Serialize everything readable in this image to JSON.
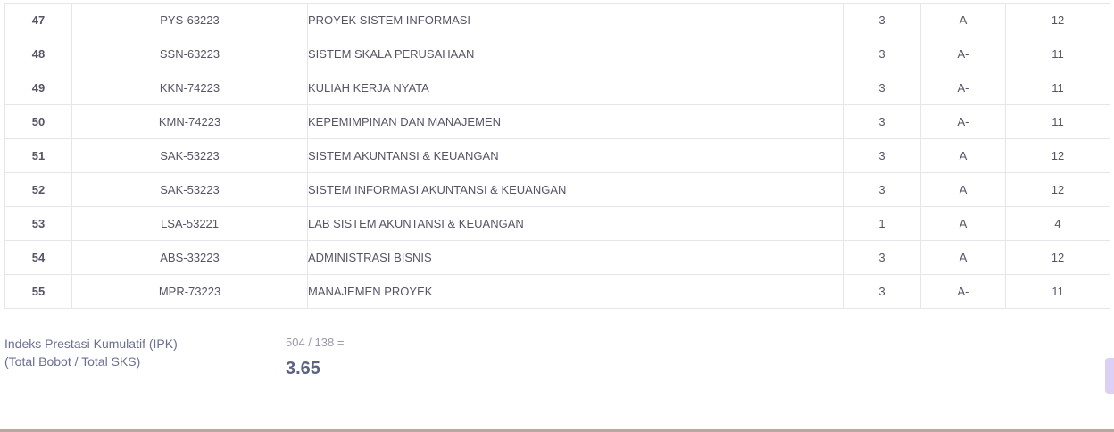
{
  "courses": [
    {
      "no": "47",
      "code": "PYS-63223",
      "name": "PROYEK SISTEM INFORMASI",
      "sks": "3",
      "grade": "A",
      "weight": "12"
    },
    {
      "no": "48",
      "code": "SSN-63223",
      "name": "SISTEM SKALA PERUSAHAAN",
      "sks": "3",
      "grade": "A-",
      "weight": "11"
    },
    {
      "no": "49",
      "code": "KKN-74223",
      "name": "KULIAH KERJA NYATA",
      "sks": "3",
      "grade": "A-",
      "weight": "11"
    },
    {
      "no": "50",
      "code": "KMN-74223",
      "name": "KEPEMIMPINAN DAN MANAJEMEN",
      "sks": "3",
      "grade": "A-",
      "weight": "11"
    },
    {
      "no": "51",
      "code": "SAK-53223",
      "name": "SISTEM AKUNTANSI & KEUANGAN",
      "sks": "3",
      "grade": "A",
      "weight": "12"
    },
    {
      "no": "52",
      "code": "SAK-53223",
      "name": "SISTEM INFORMASI AKUNTANSI & KEUANGAN",
      "sks": "3",
      "grade": "A",
      "weight": "12"
    },
    {
      "no": "53",
      "code": "LSA-53221",
      "name": "LAB SISTEM AKUNTANSI & KEUANGAN",
      "sks": "1",
      "grade": "A",
      "weight": "4"
    },
    {
      "no": "54",
      "code": "ABS-33223",
      "name": "ADMINISTRASI BISNIS",
      "sks": "3",
      "grade": "A",
      "weight": "12"
    },
    {
      "no": "55",
      "code": "MPR-73223",
      "name": "MANAJEMEN PROYEK",
      "sks": "3",
      "grade": "A-",
      "weight": "11"
    }
  ],
  "summary": {
    "label_line1": "Indeks Prestasi Kumulatif (IPK)",
    "label_line2": "(Total Bobot / Total SKS)",
    "formula": "504 / 138 =",
    "value": "3.65"
  }
}
